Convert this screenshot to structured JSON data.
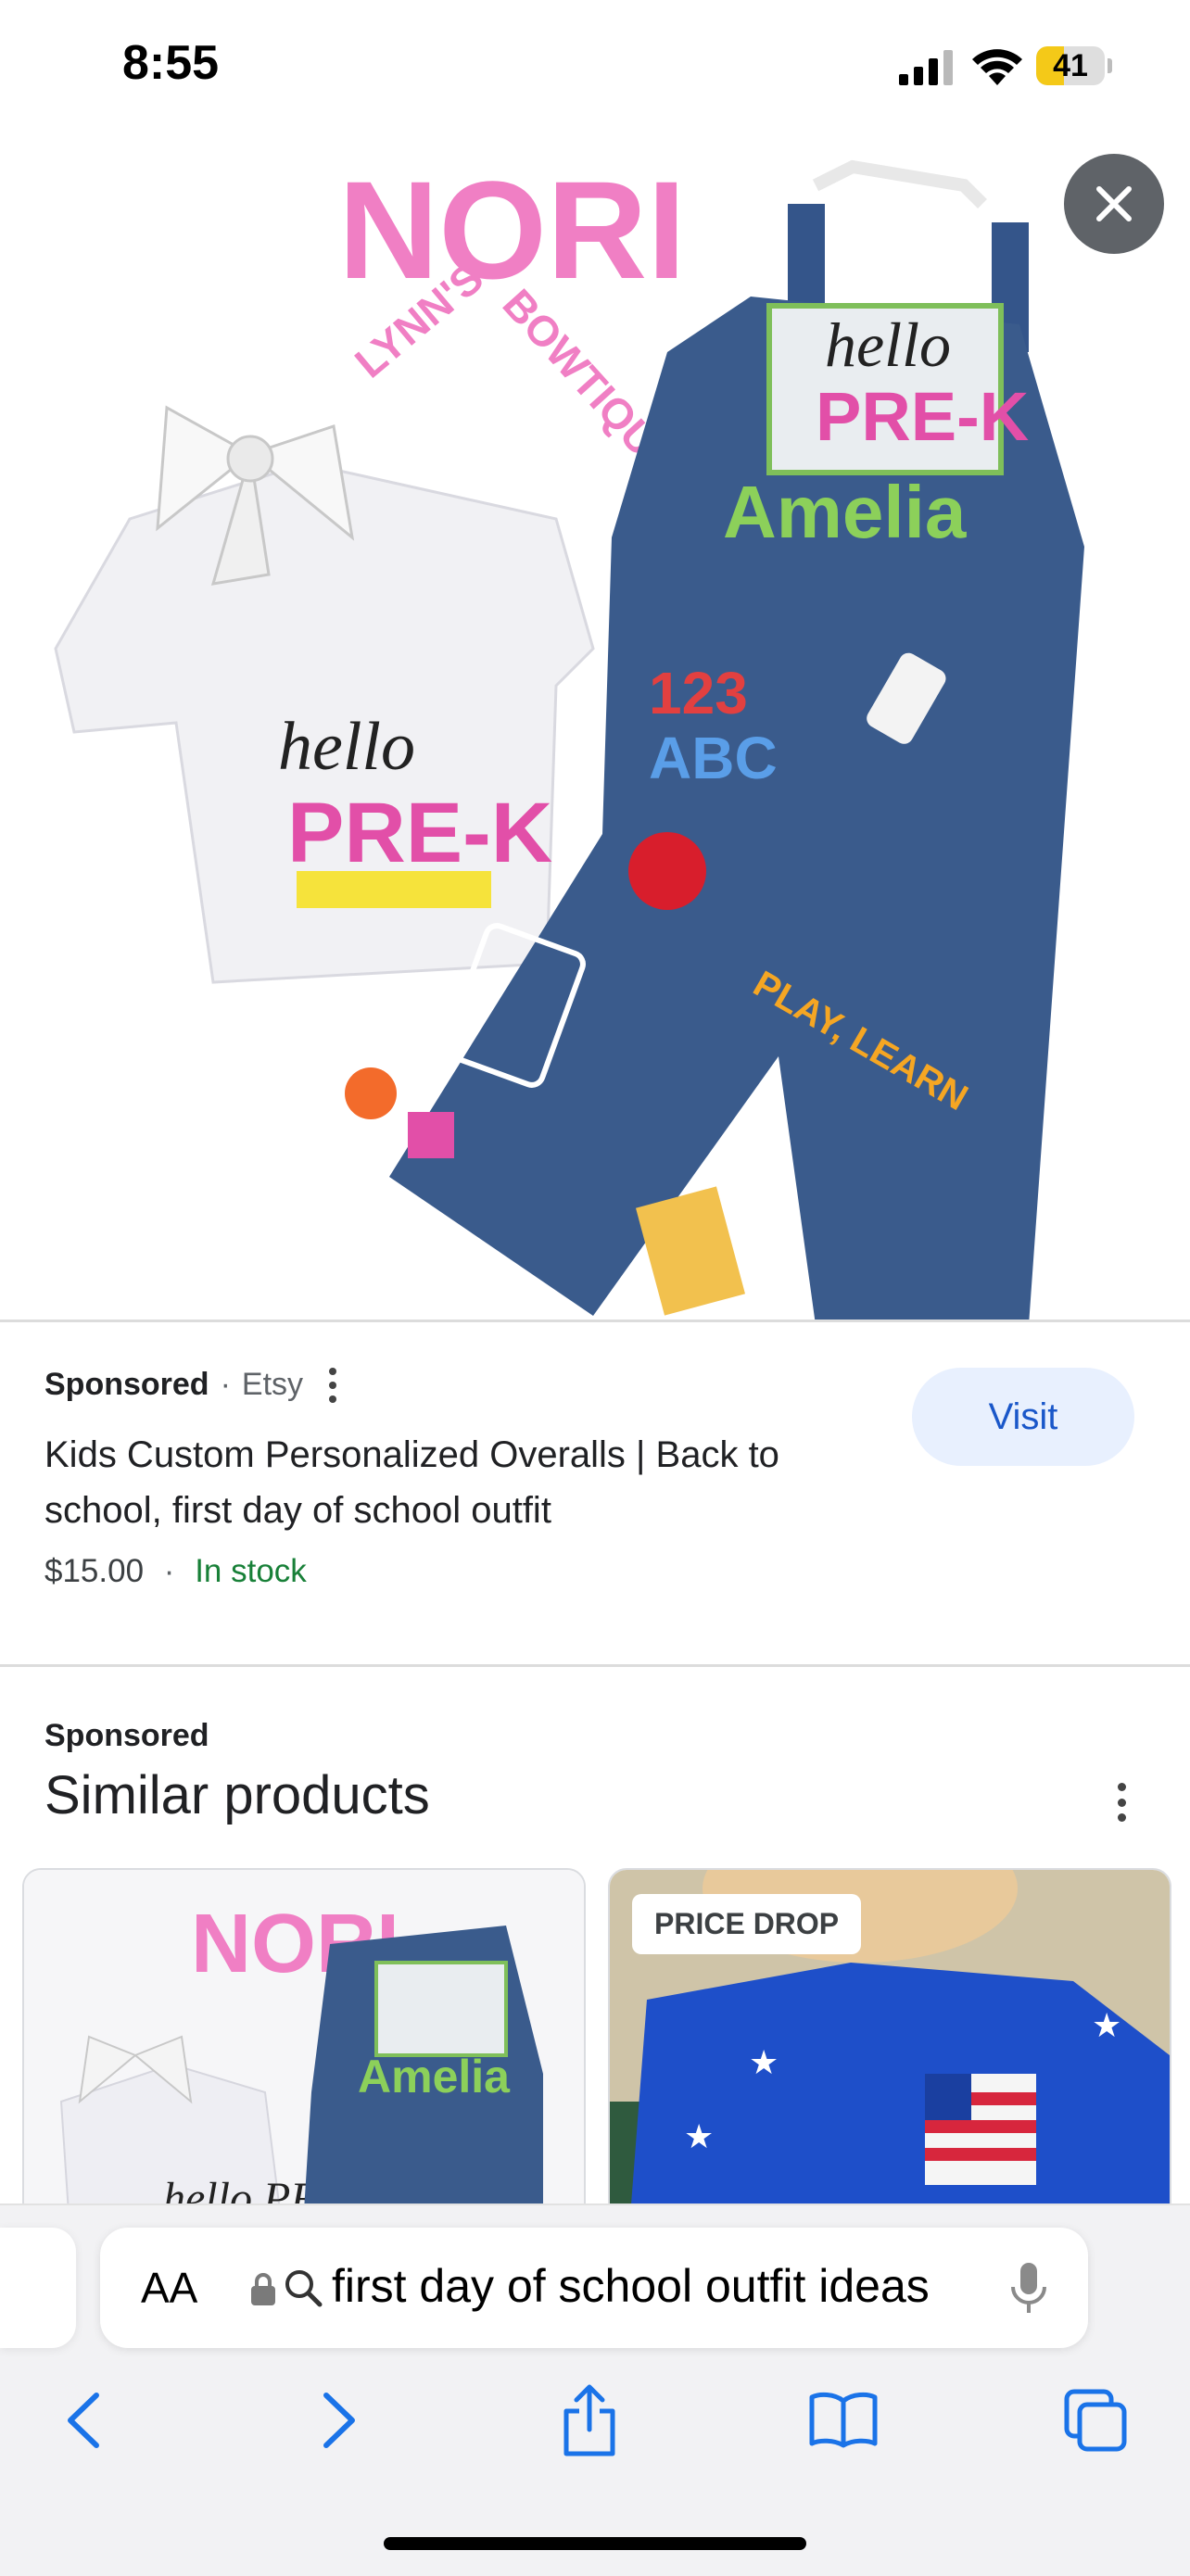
{
  "status_bar": {
    "time": "8:55",
    "battery_percent": "41",
    "battery_level": 0.41
  },
  "hero": {
    "logo_text": "NORI LYNN'S BOWTIQUE",
    "shirt_text": "hello PRE-K",
    "name_text": "Amelia"
  },
  "product": {
    "sponsored_label": "Sponsored",
    "separator": "·",
    "merchant": "Etsy",
    "title": "Kids Custom Personalized Overalls | Back to school, first day of school outfit",
    "price": "$15.00",
    "price_separator": "·",
    "stock_status": "In stock",
    "visit_label": "Visit"
  },
  "similar": {
    "sponsored_label": "Sponsored",
    "title": "Similar products",
    "cards": [
      {
        "badge": "",
        "logo_text": "NORI",
        "name_text": "Amelia",
        "shirt_text": "hello PRE-K"
      },
      {
        "badge": "PRICE DROP"
      }
    ]
  },
  "browser": {
    "aa_label": "AA",
    "search_query": "first day of school outfit ideas",
    "icons": [
      "back-icon",
      "forward-icon",
      "share-icon",
      "bookmarks-icon",
      "tabs-icon"
    ]
  },
  "colors": {
    "accent_blue": "#1a73e8",
    "visit_bg": "#e8f0fe",
    "in_stock_green": "#188038",
    "logo_pink": "#f07fc4",
    "denim": "#3a5b8c"
  }
}
